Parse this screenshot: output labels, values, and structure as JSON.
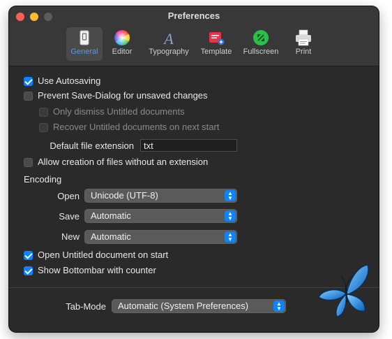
{
  "window": {
    "title": "Preferences"
  },
  "toolbar": {
    "tabs": [
      {
        "label": "General",
        "icon": "general-switch-icon",
        "active": true
      },
      {
        "label": "Editor",
        "icon": "color-wheel-icon",
        "active": false
      },
      {
        "label": "Typography",
        "icon": "typography-a-icon",
        "active": false
      },
      {
        "label": "Template",
        "icon": "template-icon",
        "active": false
      },
      {
        "label": "Fullscreen",
        "icon": "fullscreen-icon",
        "active": false
      },
      {
        "label": "Print",
        "icon": "printer-icon",
        "active": false
      }
    ]
  },
  "general": {
    "use_autosaving": {
      "label": "Use Autosaving",
      "checked": true
    },
    "prevent_save_dialog": {
      "label": "Prevent Save-Dialog for unsaved changes",
      "checked": false
    },
    "only_dismiss_untitled": {
      "label": "Only dismiss Untitled documents",
      "checked": false,
      "enabled": false
    },
    "recover_untitled": {
      "label": "Recover Untitled documents on next start",
      "checked": false,
      "enabled": false
    },
    "default_extension": {
      "label": "Default file extension",
      "value": "txt"
    },
    "allow_no_extension": {
      "label": "Allow creation of files without an extension",
      "checked": false
    },
    "encoding": {
      "heading": "Encoding",
      "open": {
        "label": "Open",
        "value": "Unicode (UTF-8)"
      },
      "save": {
        "label": "Save",
        "value": "Automatic"
      },
      "new": {
        "label": "New",
        "value": "Automatic"
      }
    },
    "open_untitled_on_start": {
      "label": "Open Untitled document on start",
      "checked": true
    },
    "show_bottombar": {
      "label": "Show Bottombar with counter",
      "checked": true
    },
    "tab_mode": {
      "label": "Tab-Mode",
      "value": "Automatic (System Preferences)"
    }
  },
  "colors": {
    "accent": "#0a84ff",
    "window_bg": "#2a2a2a",
    "titlebar_bg": "#383838"
  }
}
